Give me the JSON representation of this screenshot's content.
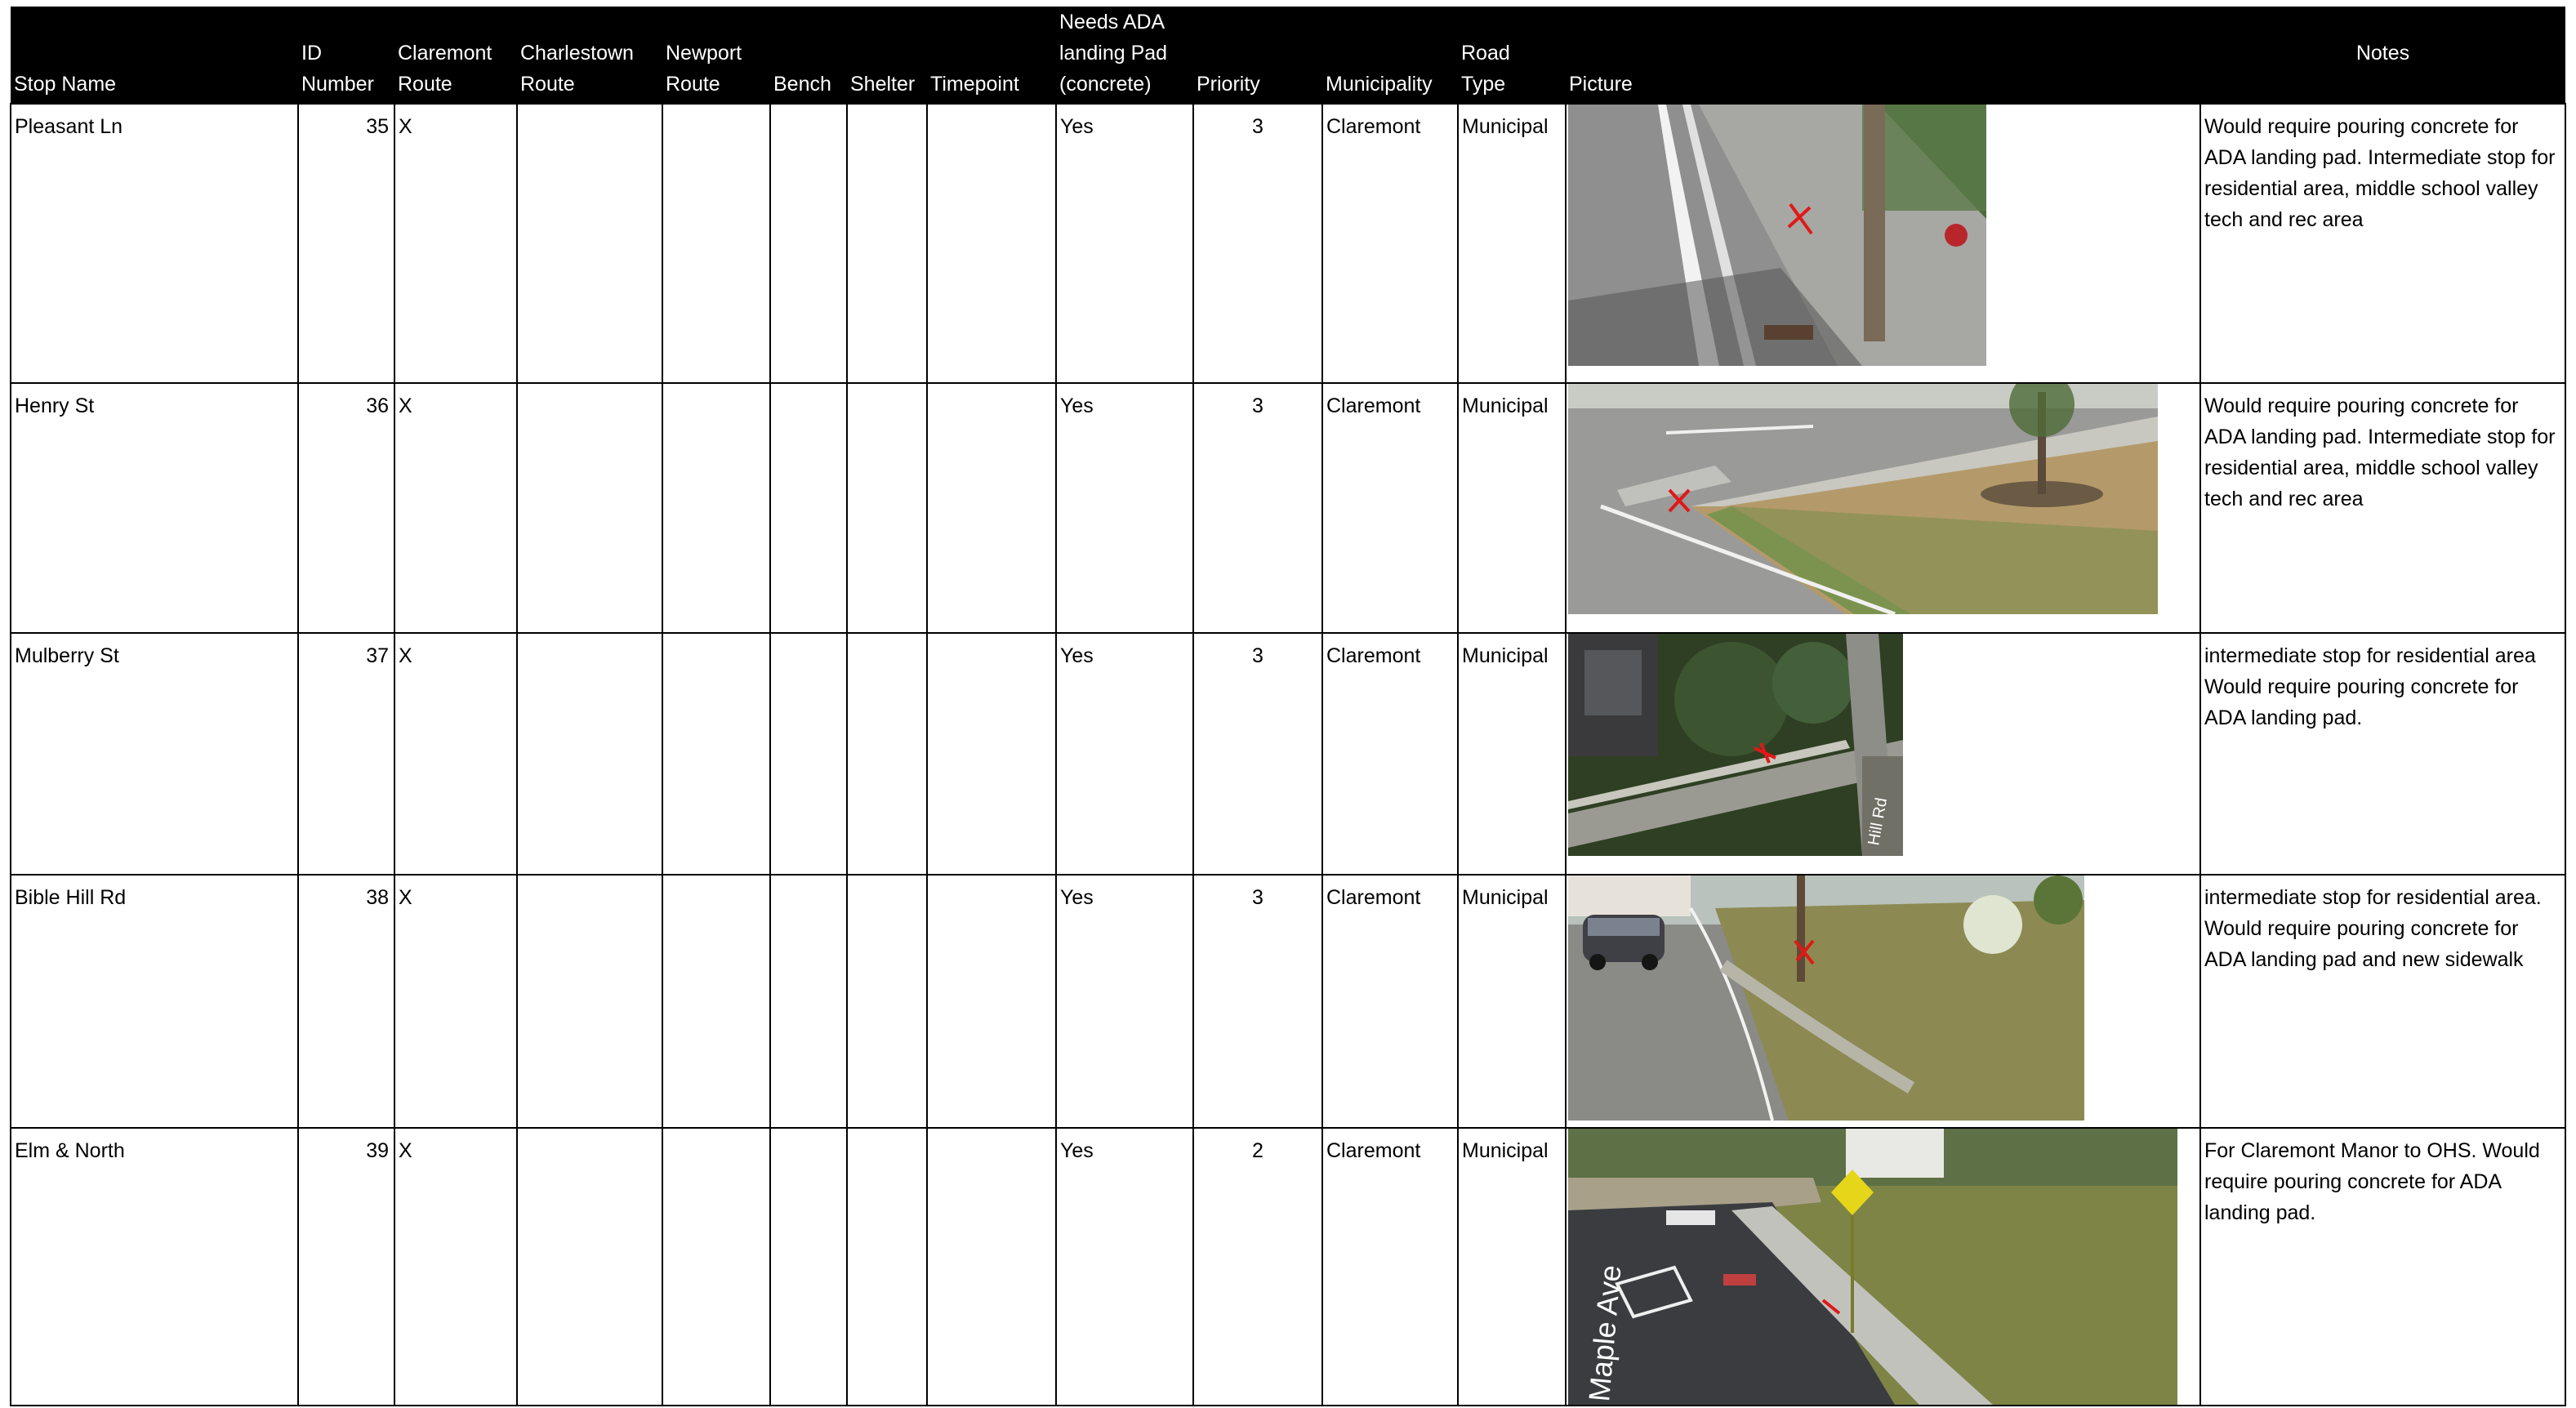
{
  "headers": {
    "stop_name": "Stop Name",
    "id_number": "ID\nNumber",
    "claremont_route": "Claremont\nRoute",
    "charlestown_route": "Charlestown\nRoute",
    "newport_route": "Newport\nRoute",
    "bench": "Bench",
    "shelter": "Shelter",
    "timepoint": "Timepoint",
    "needs_ada": "Needs ADA\nlanding Pad\n(concrete)",
    "priority": "Priority",
    "municipality": "Municipality",
    "road_type": "Road\nType",
    "picture": "Picture",
    "notes": "Notes"
  },
  "rows": [
    {
      "stop_name": "Pleasant Ln",
      "id": "35",
      "claremont": "X",
      "charlestown": "",
      "newport": "",
      "bench": "",
      "shelter": "",
      "timepoint": "",
      "needs_ada": "Yes",
      "priority": "3",
      "municipality": "Claremont",
      "road_type": "Municipal",
      "notes": "Would require pouring concrete for ADA landing pad.  Intermediate stop for residential area, middle school valley tech and rec area"
    },
    {
      "stop_name": "Henry St",
      "id": "36",
      "claremont": "X",
      "charlestown": "",
      "newport": "",
      "bench": "",
      "shelter": "",
      "timepoint": "",
      "needs_ada": "Yes",
      "priority": "3",
      "municipality": "Claremont",
      "road_type": "Municipal",
      "notes": "Would require pouring concrete for ADA landing pad.  Intermediate stop for residential area, middle school valley tech and rec area"
    },
    {
      "stop_name": "Mulberry St",
      "id": "37",
      "claremont": "X",
      "charlestown": "",
      "newport": "",
      "bench": "",
      "shelter": "",
      "timepoint": "",
      "needs_ada": "Yes",
      "priority": "3",
      "municipality": "Claremont",
      "road_type": "Municipal",
      "notes": "intermediate stop for residential area Would require pouring concrete for ADA landing pad.",
      "photo_label": "Hill Rd"
    },
    {
      "stop_name": "Bible Hill Rd",
      "id": "38",
      "claremont": "X",
      "charlestown": "",
      "newport": "",
      "bench": "",
      "shelter": "",
      "timepoint": "",
      "needs_ada": "Yes",
      "priority": "3",
      "municipality": "Claremont",
      "road_type": "Municipal",
      "notes": "intermediate stop for residential area. Would require pouring concrete for ADA landing pad and new sidewalk"
    },
    {
      "stop_name": "Elm & North",
      "id": "39",
      "claremont": "X",
      "charlestown": "",
      "newport": "",
      "bench": "",
      "shelter": "",
      "timepoint": "",
      "needs_ada": "Yes",
      "priority": "2",
      "municipality": "Claremont",
      "road_type": "Municipal",
      "notes": "For Claremont Manor to OHS.  Would require pouring concrete for ADA landing pad.",
      "photo_label": "Maple Ave"
    }
  ],
  "colors": {
    "header_bg": "#000000",
    "header_text": "#ffffff",
    "marker": "#e01818"
  }
}
